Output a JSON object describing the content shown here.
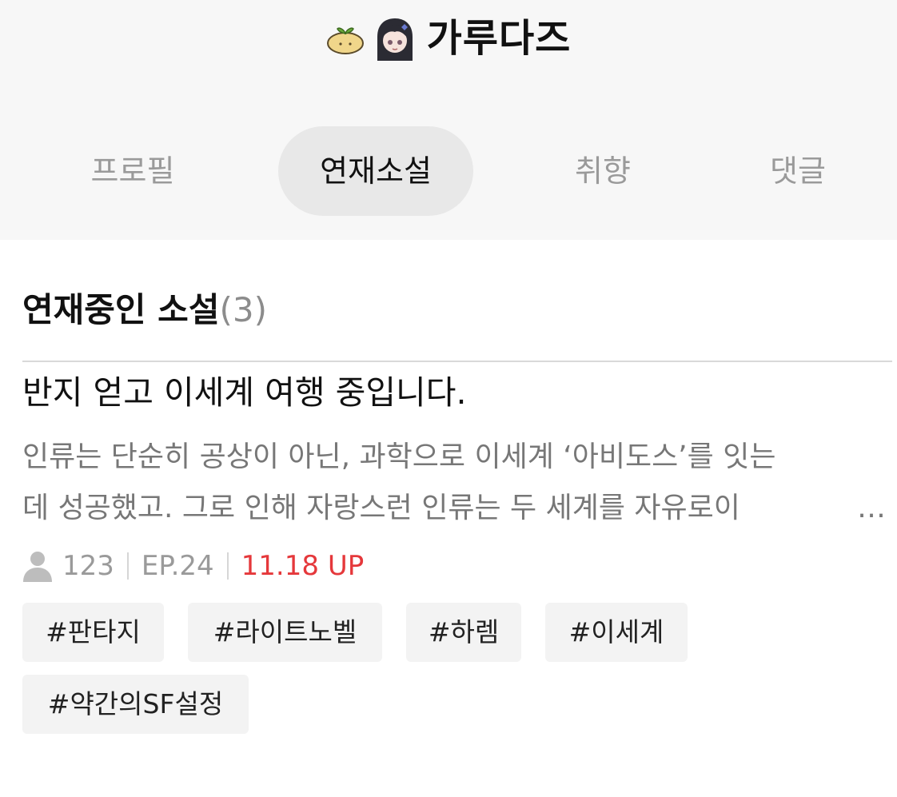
{
  "profile": {
    "nickname": "가루다즈",
    "icons": [
      "sprout-badge-icon",
      "avatar-icon"
    ]
  },
  "tabs": [
    {
      "label": "프로필",
      "active": false
    },
    {
      "label": "연재소설",
      "active": true
    },
    {
      "label": "취향",
      "active": false
    },
    {
      "label": "댓글",
      "active": false
    }
  ],
  "section": {
    "title": "연재중인 소설",
    "count": "(3)"
  },
  "novel": {
    "title": "반지 얻고 이세계 여행 중입니다.",
    "description_line1": "인류는 단순히 공상이 아닌, 과학으로 이세계 ‘아비도스’를 잇는",
    "description_line2": "데 성공했고. 그로 인해 자랑스런 인류는 두 세계를 자유로이",
    "more": "…",
    "views": "123",
    "episode": "EP.24",
    "updated": "11.18 UP",
    "tags": [
      "#판타지",
      "#라이트노벨",
      "#하렘",
      "#이세계",
      "#약간의SF설정"
    ]
  },
  "colors": {
    "header_bg": "#f7f7f7",
    "active_tab_bg": "#e8e8e8",
    "update_red": "#e5383b",
    "tag_bg": "#f3f3f3"
  }
}
